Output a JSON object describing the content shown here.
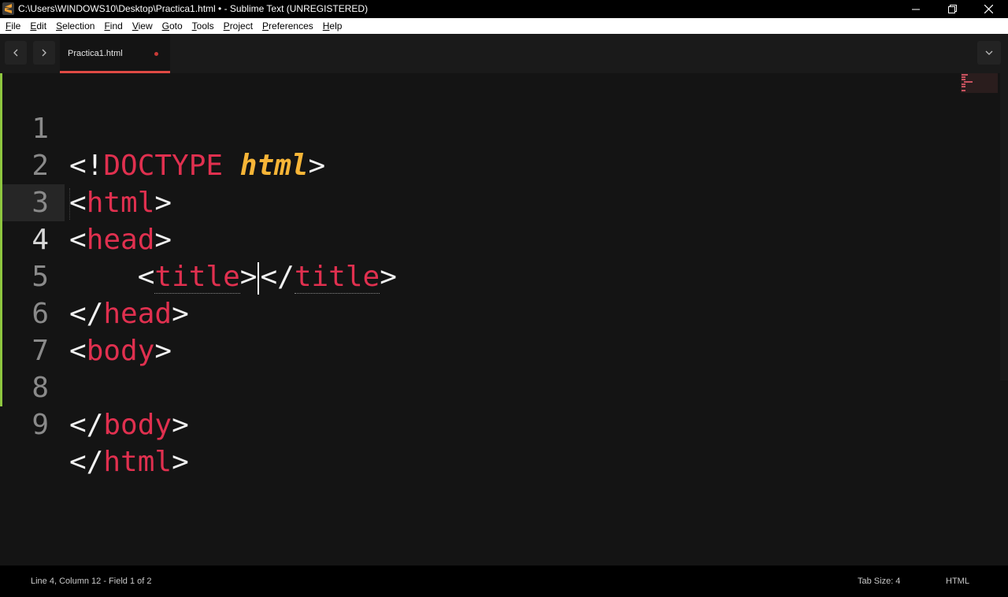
{
  "window": {
    "title": "C:\\Users\\WINDOWS10\\Desktop\\Practica1.html • - Sublime Text (UNREGISTERED)"
  },
  "menu": [
    {
      "label_ul": "F",
      "label_rest": "ile"
    },
    {
      "label_ul": "E",
      "label_rest": "dit"
    },
    {
      "label_ul": "S",
      "label_rest": "election"
    },
    {
      "label_ul": "F",
      "label_rest": "ind"
    },
    {
      "label_ul": "V",
      "label_rest": "iew"
    },
    {
      "label_ul": "G",
      "label_rest": "oto"
    },
    {
      "label_ul": "T",
      "label_rest": "ools"
    },
    {
      "label_ul": "P",
      "label_rest": "roject"
    },
    {
      "label_ul": "P",
      "label_rest": "references"
    },
    {
      "label_ul": "H",
      "label_rest": "elp"
    }
  ],
  "tab": {
    "label": "Practica1.html",
    "unsaved": true
  },
  "editor": {
    "line_numbers": [
      "1",
      "2",
      "3",
      "4",
      "5",
      "6",
      "7",
      "8",
      "9"
    ],
    "active_line": "4",
    "lines": {
      "l1": {
        "open": "<!",
        "keyword": "DOCTYPE",
        "space": " ",
        "value": "html",
        "close": ">"
      },
      "l2": {
        "open": "<",
        "tag": "html",
        "close": ">"
      },
      "l3": {
        "open": "<",
        "tag": "head",
        "close": ">"
      },
      "l4": {
        "indent": "    ",
        "open": "<",
        "tag": "title",
        "close": ">",
        "open2": "</",
        "tag2": "title",
        "close2": ">"
      },
      "l5": {
        "open": "</",
        "tag": "head",
        "close": ">"
      },
      "l6": {
        "open": "<",
        "tag": "body",
        "close": ">"
      },
      "l8": {
        "open": "</",
        "tag": "body",
        "close": ">"
      },
      "l9": {
        "open": "</",
        "tag": "html",
        "close": ">"
      }
    }
  },
  "status": {
    "position": "Line 4, Column 12 - Field 1 of 2",
    "tab_size": "Tab Size: 4",
    "syntax": "HTML"
  },
  "colors": {
    "accent_tab": "#e04a44",
    "tag": "#e0304f",
    "doctype_value": "#f7b537",
    "modified_gutter": "#8ec63f"
  },
  "icons": {
    "app": "sublime-text-icon",
    "minimize": "minimize-icon",
    "restore": "restore-icon",
    "close": "close-icon",
    "back": "chevron-left-icon",
    "forward": "chevron-right-icon",
    "tab_list": "chevron-down-icon"
  }
}
